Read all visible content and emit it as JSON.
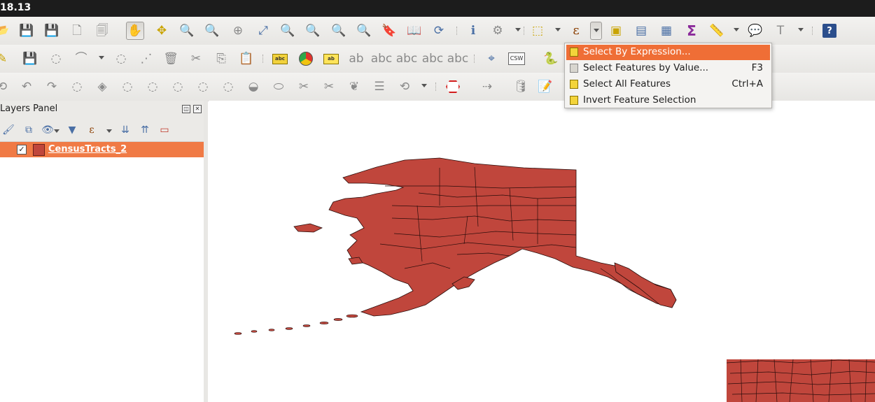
{
  "window": {
    "title": "18.13"
  },
  "menu": {
    "items": [
      {
        "label": "Select By Expression...",
        "shortcut": ""
      },
      {
        "label": "Select Features by Value...",
        "shortcut": "F3"
      },
      {
        "label": "Select All Features",
        "shortcut": "Ctrl+A"
      },
      {
        "label": "Invert Feature Selection",
        "shortcut": ""
      }
    ]
  },
  "layers_panel": {
    "title": "Layers Panel",
    "layers": [
      {
        "name": "CensusTracts_2",
        "checked": true,
        "color": "#c0463c"
      }
    ]
  },
  "toolbar": {
    "label_icon_text": "abc",
    "csw_text": "CSW",
    "help_text": "?"
  },
  "colors": {
    "accent": "#ef6e36",
    "layer_fill": "#c0463c",
    "layer_stroke": "#2a0d0b"
  }
}
